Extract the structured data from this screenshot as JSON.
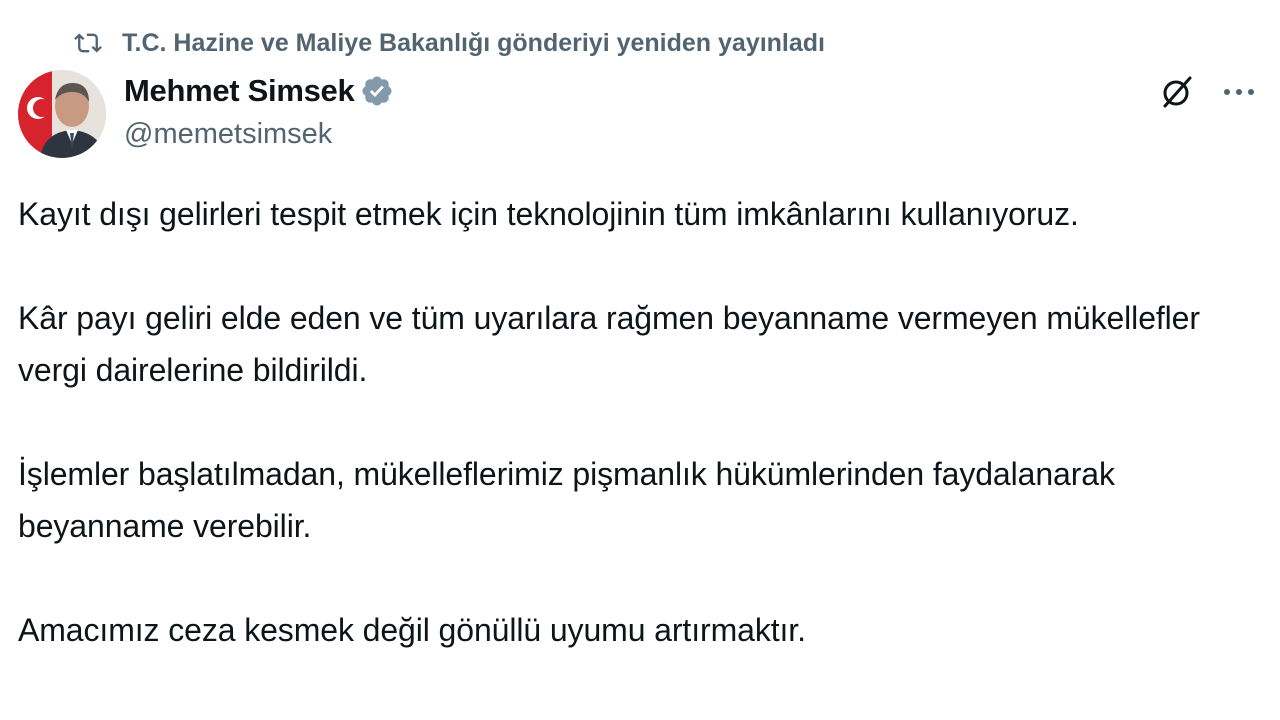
{
  "repost": {
    "icon": "repost-icon",
    "text": "T.C. Hazine ve Maliye Bakanlığı gönderiyi yeniden yayınladı"
  },
  "author": {
    "display_name": "Mehmet Simsek",
    "handle": "@memetsimsek",
    "verified": true,
    "verified_color": "#829aab"
  },
  "actions": {
    "grok_icon": "grok-icon",
    "more_icon": "more-options-icon"
  },
  "tweet": {
    "paragraphs": [
      "Kayıt dışı gelirleri tespit etmek için teknolojinin tüm imkânlarını kullanıyoruz.",
      "Kâr payı geliri elde eden ve tüm uyarılara rağmen beyanname vermeyen mükellefler vergi dairelerine bildirildi.",
      "İşlemler başlatılmadan, mükelleflerimiz pişmanlık hükümlerinden faydalanarak beyanname verebilir.",
      "Amacımız ceza kesmek değil gönüllü uyumu artırmaktır."
    ]
  },
  "colors": {
    "text_primary": "#0f1419",
    "text_secondary": "#536471"
  }
}
